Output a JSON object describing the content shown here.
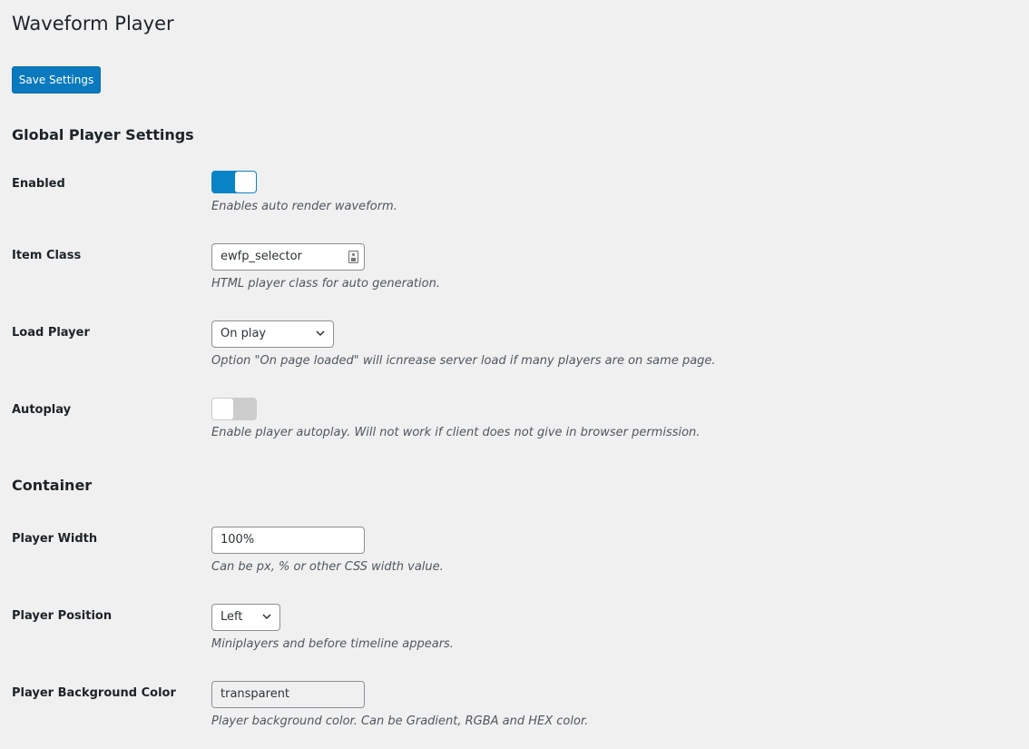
{
  "page": {
    "title": "Waveform Player",
    "save_label": "Save Settings"
  },
  "colors": {
    "accent": "#0a79bd",
    "toggle_on": "#0a84c6",
    "toggle_off": "#cccccc",
    "background": "#f0f0f1"
  },
  "sections": {
    "global": {
      "title": "Global Player Settings",
      "enabled": {
        "label": "Enabled",
        "value": true,
        "description": "Enables auto render waveform."
      },
      "item_class": {
        "label": "Item Class",
        "value": "ewfp_selector",
        "icon": "contact-card-icon",
        "description": "HTML player class for auto generation."
      },
      "load_player": {
        "label": "Load Player",
        "value": "On play",
        "description": "Option \"On page loaded\" will icnrease server load if many players are on same page."
      },
      "autoplay": {
        "label": "Autoplay",
        "value": false,
        "description": "Enable player autoplay. Will not work if client does not give in browser permission."
      }
    },
    "container": {
      "title": "Container",
      "player_width": {
        "label": "Player Width",
        "value": "100%",
        "description": "Can be px, % or other CSS width value."
      },
      "player_position": {
        "label": "Player Position",
        "value": "Left",
        "description": "Miniplayers and before timeline appears."
      },
      "player_bg_color": {
        "label": "Player Background Color",
        "value": "transparent",
        "description": "Player background color. Can be Gradient, RGBA and HEX color."
      }
    }
  }
}
